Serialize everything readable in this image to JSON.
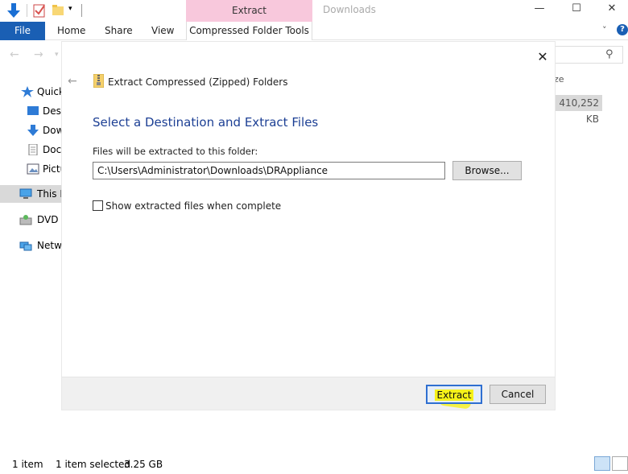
{
  "window": {
    "context_tab": "Extract",
    "title": "Downloads",
    "minimize": "—",
    "maximize": "☐",
    "close": "✕"
  },
  "ribbon": {
    "tabs": [
      "File",
      "Home",
      "Share",
      "View"
    ],
    "context_tab_label": "Compressed Folder Tools",
    "expand": "˅",
    "help": "?"
  },
  "nav_pane": {
    "items": [
      {
        "label": "Quick access",
        "icon": "star-icon"
      },
      {
        "label": "Desktop",
        "icon": "desktop-icon"
      },
      {
        "label": "Downloads",
        "icon": "download-arrow-icon"
      },
      {
        "label": "Documents",
        "icon": "document-icon"
      },
      {
        "label": "Pictures",
        "icon": "pictures-icon"
      },
      {
        "label": "This PC",
        "icon": "computer-icon"
      },
      {
        "label": "DVD Drive",
        "icon": "dvd-icon"
      },
      {
        "label": "Network",
        "icon": "network-icon"
      }
    ]
  },
  "file_list": {
    "size_header": "ze",
    "size_value": "410,252 KB"
  },
  "dialog": {
    "title": "Extract Compressed (Zipped) Folders",
    "heading": "Select a Destination and Extract Files",
    "label": "Files will be extracted to this folder:",
    "path": "C:\\Users\\Administrator\\Downloads\\DRAppliance",
    "browse": "Browse...",
    "show_files": "Show extracted files when complete",
    "extract": "Extract",
    "cancel": "Cancel",
    "close": "✕",
    "back": "←"
  },
  "status_bar": {
    "count": "1 item",
    "selected": "1 item selected",
    "size": "3.25 GB"
  },
  "colors": {
    "file_tab": "#1a5fb4",
    "context_tab": "#f8c8dc",
    "heading": "#1c3f94",
    "highlight": "#f6f21a"
  }
}
